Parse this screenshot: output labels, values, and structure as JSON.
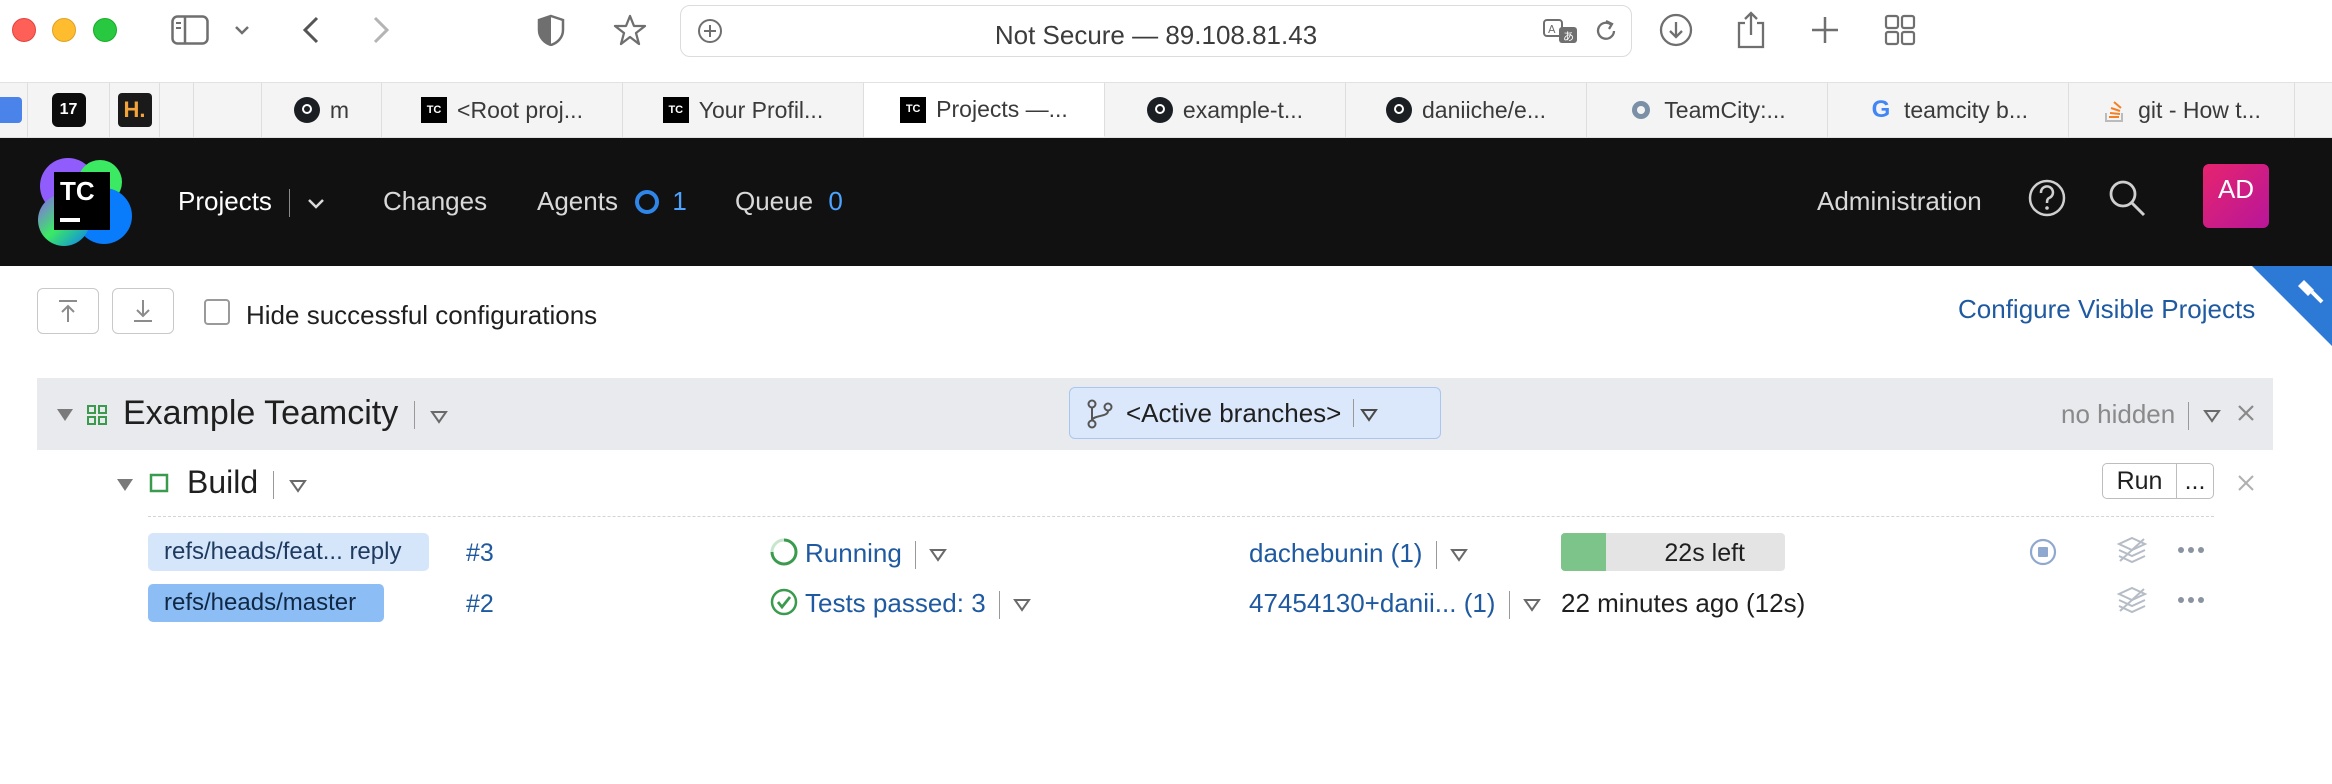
{
  "browser": {
    "address": "Not Secure — 89.108.81.43",
    "tabs": [
      {
        "label": "m",
        "icon": "github-icon"
      },
      {
        "label": "<Root proj...",
        "icon": "teamcity-icon"
      },
      {
        "label": "Your Profil...",
        "icon": "teamcity-icon"
      },
      {
        "label": "Projects —...",
        "icon": "teamcity-icon",
        "active": true
      },
      {
        "label": "example-t...",
        "icon": "github-icon"
      },
      {
        "label": "daniiche/e...",
        "icon": "github-icon"
      },
      {
        "label": "TeamCity:...",
        "icon": "teamcity-gear-icon"
      },
      {
        "label": "teamcity b...",
        "icon": "google-icon"
      },
      {
        "label": "git - How t...",
        "icon": "stackoverflow-icon"
      }
    ]
  },
  "header": {
    "logo": "TC",
    "nav": {
      "projects": "Projects",
      "changes": "Changes",
      "agents": "Agents",
      "agents_count": "1",
      "queue": "Queue",
      "queue_count": "0"
    },
    "administration": "Administration",
    "avatar_initials": "AD"
  },
  "toolbar": {
    "hide_successful": "Hide successful configurations",
    "hide_successful_checked": false,
    "configure_visible": "Configure Visible Projects"
  },
  "project": {
    "name": "Example Teamcity",
    "branch_filter": "<Active branches>",
    "hidden_status": "no hidden"
  },
  "build_config": {
    "name": "Build",
    "run_label": "Run",
    "more_label": "...",
    "builds": [
      {
        "branch": "refs/heads/feat... reply",
        "number": "#3",
        "status": "Running",
        "changes": "dachebunin (1)",
        "time_left": "22s left",
        "progress": 0.2
      },
      {
        "branch": "refs/heads/master",
        "number": "#2",
        "status": "Tests passed: 3",
        "changes": "47454130+danii... (1)",
        "finished": "22 minutes ago (12s)"
      }
    ]
  },
  "colors": {
    "header_bg": "#111112",
    "accent_blue": "#1f5aa0",
    "progress_green": "#7cc48a",
    "success_green": "#3a9b4f"
  }
}
